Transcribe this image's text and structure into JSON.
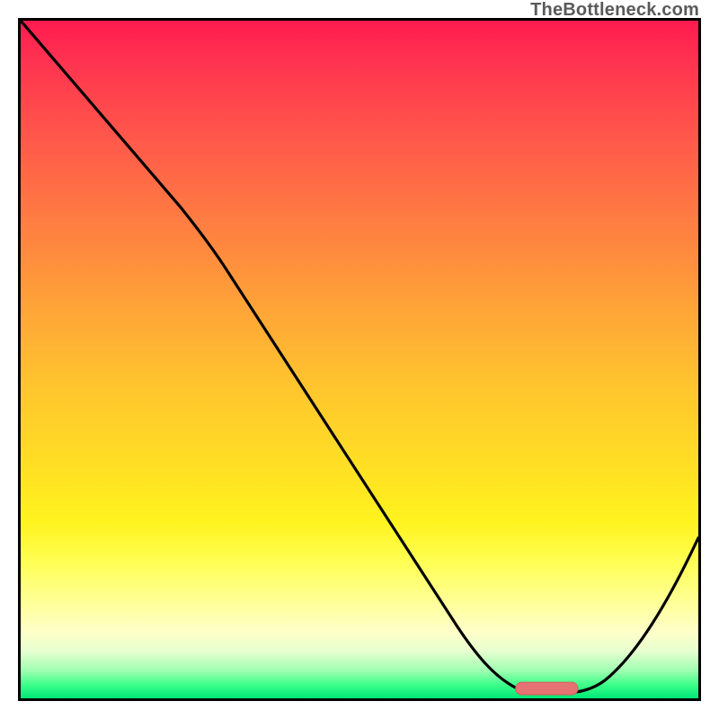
{
  "watermark": "TheBottleneck.com",
  "colors": {
    "border": "#000000",
    "curve": "#000000",
    "marker_fill": "#e57373",
    "marker_stroke": "#d85c5c"
  },
  "chart_data": {
    "type": "line",
    "title": "",
    "xlabel": "",
    "ylabel": "",
    "xlim": [
      0,
      100
    ],
    "ylim": [
      0,
      100
    ],
    "grid": false,
    "series": [
      {
        "name": "curve",
        "x": [
          0,
          8,
          16,
          24,
          32,
          40,
          48,
          56,
          64,
          70,
          74,
          78,
          82,
          86,
          90,
          95,
          100
        ],
        "y": [
          100,
          90,
          80,
          72,
          61,
          49,
          38,
          27,
          15,
          6,
          2,
          0,
          0,
          1,
          6,
          15,
          28
        ]
      }
    ],
    "marker": {
      "x_start": 74,
      "x_end": 82,
      "y": 0
    }
  }
}
